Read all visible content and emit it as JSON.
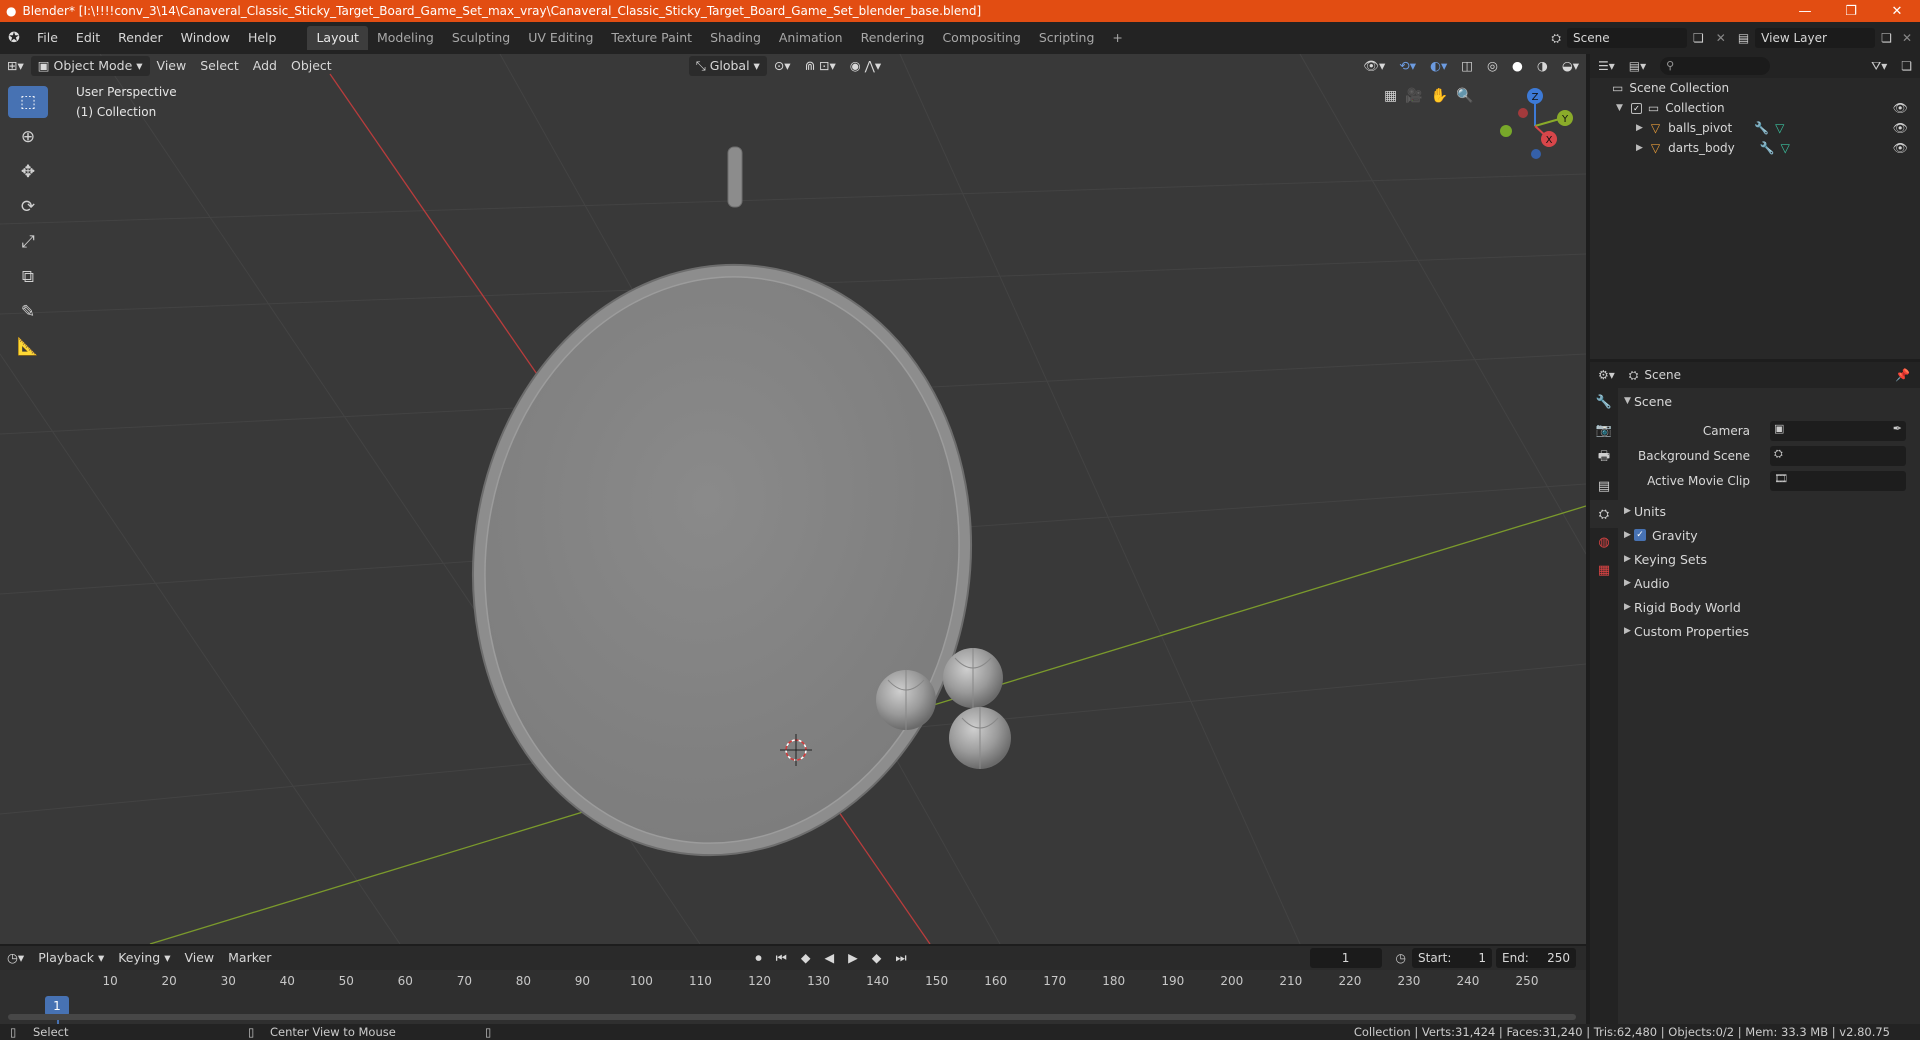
{
  "window": {
    "title": "Blender* [I:\\!!!!conv_3\\14\\Canaveral_Classic_Sticky_Target_Board_Game_Set_max_vray\\Canaveral_Classic_Sticky_Target_Board_Game_Set_blender_base.blend]",
    "minimize": "—",
    "maximize": "❐",
    "close": "✕"
  },
  "menubar": {
    "menus": [
      "File",
      "Edit",
      "Render",
      "Window",
      "Help"
    ],
    "workspaces": [
      "Layout",
      "Modeling",
      "Sculpting",
      "UV Editing",
      "Texture Paint",
      "Shading",
      "Animation",
      "Rendering",
      "Compositing",
      "Scripting"
    ],
    "add_tab": "+",
    "scene": "Scene",
    "view_layer": "View Layer"
  },
  "viewport": {
    "mode": "Object Mode",
    "menus": [
      "View",
      "Select",
      "Add",
      "Object"
    ],
    "orientation": "Global",
    "perspective_label": "User Perspective",
    "collection_label": "(1) Collection",
    "gizmo": {
      "z": "Z",
      "y": "Y",
      "x": "X"
    }
  },
  "outliner": {
    "root": "Scene Collection",
    "collection": "Collection",
    "objects": [
      "balls_pivot",
      "darts_body"
    ]
  },
  "properties": {
    "header": "Scene",
    "panel": "Scene",
    "fields": [
      {
        "label": "Camera"
      },
      {
        "label": "Background Scene"
      },
      {
        "label": "Active Movie Clip"
      }
    ],
    "sections": [
      "Units",
      "Gravity",
      "Keying Sets",
      "Audio",
      "Rigid Body World",
      "Custom Properties"
    ]
  },
  "timeline": {
    "menus": [
      "Playback",
      "Keying",
      "View",
      "Marker"
    ],
    "current_frame": "1",
    "start_label": "Start:",
    "start": "1",
    "end_label": "End:",
    "end": "250",
    "ticks": [
      "10",
      "20",
      "30",
      "40",
      "50",
      "60",
      "70",
      "80",
      "90",
      "100",
      "110",
      "120",
      "130",
      "140",
      "150",
      "160",
      "170",
      "180",
      "190",
      "200",
      "210",
      "220",
      "230",
      "240",
      "250"
    ],
    "badge": "1"
  },
  "statusbar": {
    "left": "Select",
    "middle": "Center View to Mouse",
    "right": "Collection | Verts:31,424 | Faces:31,240 | Tris:62,480 | Objects:0/2 | Mem: 33.3 MB | v2.80.75"
  },
  "colors": {
    "accent": "#4772b3",
    "titlebar": "#e24d12",
    "viewport_bg": "#393939",
    "x_axis": "#b83c3c",
    "y_axis": "#7b9a2c"
  }
}
